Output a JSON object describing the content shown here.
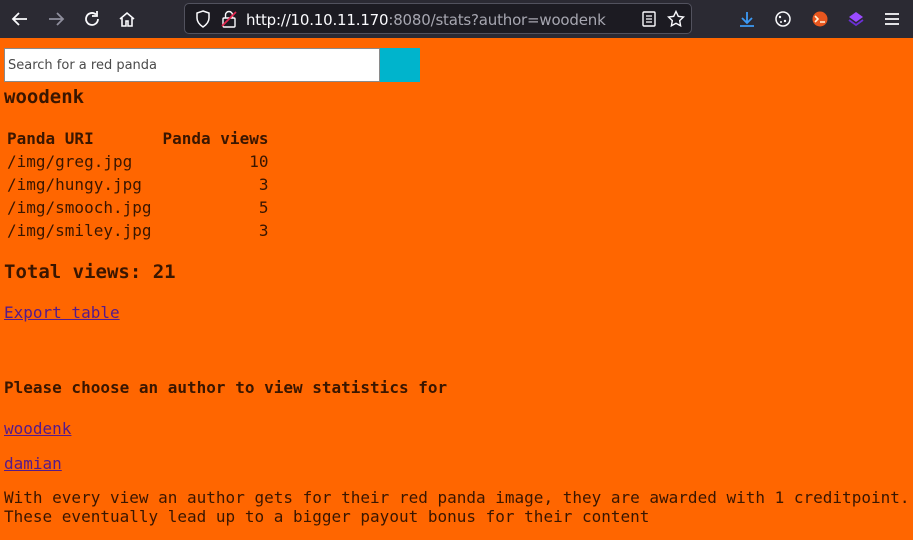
{
  "browser": {
    "url_host": "http://10.10.11.170",
    "url_rest": ":8080/stats?author=woodenk",
    "icons": [
      "back-icon",
      "forward-icon",
      "reload-icon",
      "home-icon",
      "shield-icon",
      "insecure-lock-icon",
      "reader-mode-icon",
      "bookmark-star-icon",
      "download-icon",
      "cookie-extension-icon",
      "foxyproxy-extension-icon",
      "wappalyzer-extension-icon",
      "menu-icon"
    ]
  },
  "search": {
    "placeholder": "Search for a red panda",
    "button_color": "#00b4cc"
  },
  "author": "woodenk",
  "table": {
    "headers": [
      "Panda URI",
      "Panda views"
    ],
    "rows": [
      {
        "uri": "/img/greg.jpg",
        "views": "10"
      },
      {
        "uri": "/img/hungy.jpg",
        "views": "3"
      },
      {
        "uri": "/img/smooch.jpg",
        "views": "5"
      },
      {
        "uri": "/img/smiley.jpg",
        "views": "3"
      }
    ]
  },
  "total_views": "Total views: 21",
  "export_link": "Export table",
  "choose_heading": "Please choose an author to view statistics for",
  "authors": [
    "woodenk",
    "damian"
  ],
  "info_line1": "With every view an author gets for their red panda image, they are awarded with 1 creditpoint.",
  "info_line2": "These eventually lead up to a bigger payout bonus for their content",
  "colors": {
    "page_background": "#ff6600",
    "link": "#551a8b",
    "toolbar": "#2b2a33"
  }
}
